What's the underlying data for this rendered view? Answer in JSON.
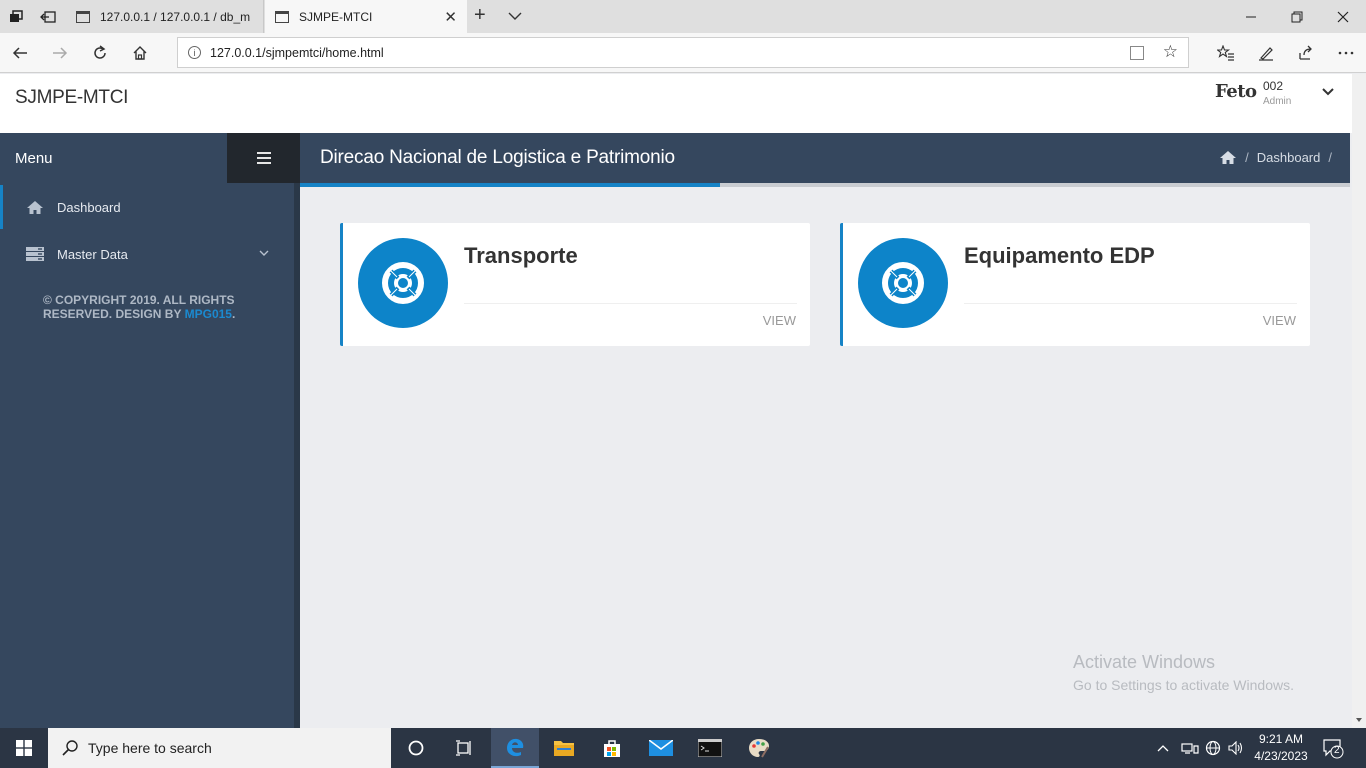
{
  "browser": {
    "tabs": [
      {
        "label": "127.0.0.1 / 127.0.0.1 / db_m",
        "active": false
      },
      {
        "label": "SJMPE-MTCI",
        "active": true
      }
    ],
    "address": "127.0.0.1/sjmpemtci/home.html",
    "new_tab_symbol": "+"
  },
  "header": {
    "brand": "SJMPE-MTCI",
    "user_name": "Feto",
    "user_id": "002",
    "user_role": "Admin"
  },
  "sidebar": {
    "menu_title": "Menu",
    "items": [
      {
        "label": "Dashboard",
        "icon": "home-icon",
        "active": true
      },
      {
        "label": "Master Data",
        "icon": "server-icon",
        "expandable": true
      }
    ],
    "copyright_text": "© COPYRIGHT 2019. ALL RIGHTS RESERVED. DESIGN BY ",
    "copyright_link": "MPG015",
    "copyright_end": "."
  },
  "content": {
    "title": "Direcao Nacional de Logistica e Patrimonio",
    "breadcrumb": {
      "home_icon": "home-icon",
      "current": "Dashboard",
      "separator": "/"
    },
    "progress": 0.4,
    "cards": [
      {
        "title": "Transporte",
        "action": "VIEW",
        "icon": "life-ring-icon"
      },
      {
        "title": "Equipamento EDP",
        "action": "VIEW",
        "icon": "life-ring-icon"
      }
    ]
  },
  "watermark": {
    "line1": "Activate Windows",
    "line2": "Go to Settings to activate Windows."
  },
  "taskbar": {
    "search_placeholder": "Type here to search",
    "time": "9:21 AM",
    "date": "4/23/2023",
    "notifications": "2"
  },
  "colors": {
    "accent": "#1683c6",
    "sidebar": "#35475e",
    "hamburger_bg": "#22272d",
    "card_icon": "#0d84c9",
    "page_bg": "#ecedf0"
  }
}
